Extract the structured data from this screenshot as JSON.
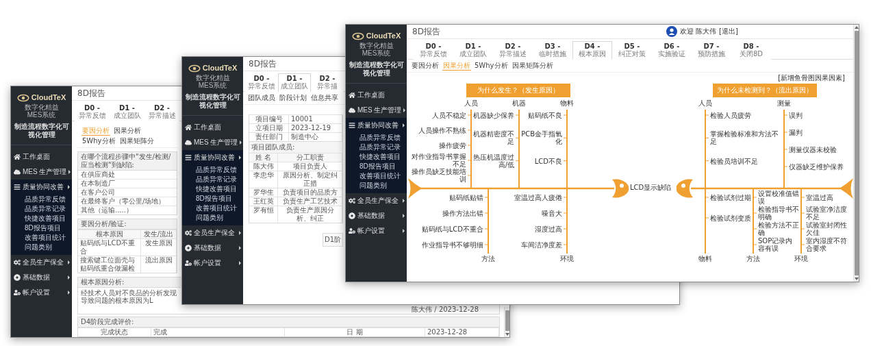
{
  "windows": [
    {
      "kind": "defect_analysis",
      "page_title": "8D报告",
      "sidebar": {
        "logo": "CloudTeX",
        "logo_subtitle": "数字化精益MES系统",
        "tagline": "制造流程数字化可视化管理",
        "menu": [
          {
            "label": "工作桌面",
            "submenu": false,
            "expanded": false
          },
          {
            "label": "MES 生产管理",
            "submenu": true,
            "expanded": false
          },
          {
            "label": "质量协同改善",
            "submenu": true,
            "expanded": true,
            "children": [
              "品质异常反馈",
              "品质异常记录",
              "快捷改善项目",
              "8D报告项目",
              "改善项目统计",
              "问题类别"
            ]
          },
          {
            "label": "全员生产保全",
            "submenu": true,
            "expanded": false
          },
          {
            "label": "基础数据",
            "submenu": true,
            "expanded": false
          },
          {
            "label": "帐户设置",
            "submenu": true,
            "expanded": false
          }
        ]
      },
      "steps": [
        {
          "code": "D0 -",
          "label": "异常反馈",
          "selected": false
        },
        {
          "code": "D1 -",
          "label": "成立团队",
          "selected": false
        },
        {
          "code": "D2 -",
          "label": "异常描述",
          "selected": false
        }
      ],
      "subtabs": [
        {
          "label": "要因分析",
          "selected": true
        },
        {
          "label": "因果分析",
          "selected": false
        },
        {
          "label": "5Why分析",
          "selected": false
        },
        {
          "label": "因果矩阵分",
          "selected": false
        }
      ],
      "location_box": {
        "title": "在哪个流程步骤中\"发生/检测/应当检测\"到缺陷:",
        "options": [
          "在供应商处",
          "在本制造厂",
          "在客户公司",
          "在最终客户（零公里/场地）",
          "其他（运输.....）"
        ]
      },
      "cause_table": {
        "title": "要因分析/验证:",
        "columns": [
          "根本原因",
          "发生/流出"
        ],
        "rows": [
          [
            "贴码纸与LCD不重合",
            "发生原因"
          ],
          [
            "搜索键工位面壳与贴码纸重合做漏检",
            "流出原因"
          ]
        ]
      },
      "root_cause": {
        "title": "根本原因分析:",
        "text": "经技术人员对不良品的分析发现导致问题的根本原因为L",
        "signature": "陈大伟 / 2023-12-28"
      },
      "evaluation": {
        "title": "D4阶段完成评价:",
        "cells": [
          "完成状态",
          "完成",
          "日 期",
          "2023-12-28"
        ]
      }
    },
    {
      "kind": "team",
      "page_title": "8D报告",
      "sidebar": {
        "logo": "CloudTeX",
        "logo_subtitle": "数字化精益MES系统",
        "tagline": "制造流程数字化可视化管理",
        "menu": [
          {
            "label": "工作桌面",
            "submenu": false,
            "expanded": false
          },
          {
            "label": "MES 生产管理",
            "submenu": true,
            "expanded": false
          },
          {
            "label": "质量协同改善",
            "submenu": true,
            "expanded": true,
            "children": [
              "品质异常反馈",
              "品质异常记录",
              "快捷改善项目",
              "8D报告项目",
              "改善项目统计",
              "问题类别"
            ]
          },
          {
            "label": "全员生产保全",
            "submenu": true,
            "expanded": false
          },
          {
            "label": "基础数据",
            "submenu": true,
            "expanded": false
          },
          {
            "label": "帐户设置",
            "submenu": true,
            "expanded": false
          }
        ]
      },
      "steps": [
        {
          "code": "D0 -",
          "label": "异常反馈",
          "selected": false
        },
        {
          "code": "D1 -",
          "label": "成立团队",
          "selected": true
        },
        {
          "code": "D2 -",
          "label": "异常描",
          "selected": false
        }
      ],
      "subtabs": [
        {
          "label": "团队成员",
          "selected": false
        },
        {
          "label": "阶段计划",
          "selected": false
        },
        {
          "label": "信息共享",
          "selected": false
        }
      ],
      "project_info": [
        {
          "label": "项目编号",
          "value": "10001"
        },
        {
          "label": "立项日期",
          "value": "2023-12-19"
        },
        {
          "label": "责任部门",
          "value": "制造中心"
        }
      ],
      "team_title": "项目团队成员:",
      "team_columns": [
        "姓 名",
        "分工职责"
      ],
      "members": [
        {
          "name": "陈大伟",
          "duty": "项目负责人"
        },
        {
          "name": "李忠华",
          "duty": "原因分析、制定纠正措"
        },
        {
          "name": "罗华生",
          "duty": "负责项目的品质方"
        },
        {
          "name": "王红英",
          "duty": "负责生产工艺技术"
        },
        {
          "name": "罗有恒",
          "duty": "负责生产原因分析、纠正"
        }
      ],
      "next_section_title": "D1阶"
    },
    {
      "kind": "fishbone",
      "page_title": "8D报告",
      "user": {
        "greeting": "欢迎 陈大伟",
        "logout": "[退出]"
      },
      "sidebar": {
        "logo": "CloudTeX",
        "logo_subtitle": "数字化精益MES系统",
        "tagline": "制造流程数字化可视化管理",
        "menu": [
          {
            "label": "工作桌面",
            "submenu": false,
            "expanded": false
          },
          {
            "label": "MES 生产管理",
            "submenu": true,
            "expanded": false
          },
          {
            "label": "质量协同改善",
            "submenu": true,
            "expanded": true,
            "children": [
              "品质异常反馈",
              "品质异常记录",
              "快捷改善项目",
              "8D报告项目",
              "改善项目统计",
              "问题类别"
            ]
          },
          {
            "label": "全员生产保全",
            "submenu": true,
            "expanded": false
          },
          {
            "label": "基础数据",
            "submenu": true,
            "expanded": false
          },
          {
            "label": "帐户设置",
            "submenu": true,
            "expanded": false
          }
        ]
      },
      "steps": [
        {
          "code": "D0 -",
          "label": "异常反馈",
          "selected": false
        },
        {
          "code": "D1 -",
          "label": "成立团队",
          "selected": false
        },
        {
          "code": "D2 -",
          "label": "异常描述",
          "selected": false
        },
        {
          "code": "D3 -",
          "label": "临时措施",
          "selected": false
        },
        {
          "code": "D4 -",
          "label": "根本原因",
          "selected": true
        },
        {
          "code": "D5 -",
          "label": "纠正对策",
          "selected": false
        },
        {
          "code": "D6 -",
          "label": "实施验证",
          "selected": false
        },
        {
          "code": "D7 -",
          "label": "预防措施",
          "selected": false
        },
        {
          "code": "D8 -",
          "label": "关闭8D",
          "selected": false
        }
      ],
      "subtabs": [
        {
          "label": "要因分析",
          "selected": false
        },
        {
          "label": "因果分析",
          "selected": true
        },
        {
          "label": "5Why分析",
          "selected": false
        },
        {
          "label": "因果矩阵分析",
          "selected": false
        }
      ],
      "add_link": "[新增鱼骨图因果因素]",
      "diagram": {
        "effect": "LCD显示缺陷",
        "fishes": [
          {
            "title": "为什么发生？（发生原因）",
            "head_right": true,
            "top_categories": [
              {
                "name": "人员",
                "causes": [
                  "人员不稳定",
                  "人员操作不熟练",
                  "操作疲劳",
                  "对作业指导书掌握不足",
                  "操作员缺乏技能培训"
                ]
              },
              {
                "name": "机器",
                "causes": [
                  "机器缺少保养",
                  "机器精密度不足",
                  "热压机温度过高/低"
                ]
              },
              {
                "name": "物料",
                "causes": [
                  "贴码纸不良",
                  "PCB金手指氧化",
                  "LCD不良"
                ]
              }
            ],
            "bottom_categories": [
              {
                "name": "方法",
                "causes": [
                  "贴码纸贴错",
                  "操作方法出错",
                  "贴码纸与LCD不重合",
                  "作业指导书不够明细"
                ]
              },
              {
                "name": "环境",
                "causes": [
                  "室温过高人疲倦",
                  "噪音大",
                  "湿度过高",
                  "车间洁净度差"
                ]
              }
            ]
          },
          {
            "title": "为什么未检测到？（流出原因）",
            "head_right": false,
            "top_categories": [
              {
                "name": "人员",
                "causes": [
                  "检验人员疲劳",
                  "掌握检验标准和方法不足",
                  "检验员培训不足"
                ]
              },
              {
                "name": "测量",
                "causes": [
                  "误判",
                  "漏判",
                  "测量仪器未校验",
                  "仪器缺乏维护保养"
                ]
              }
            ],
            "bottom_categories": [
              {
                "name": "物料",
                "causes": [
                  "检验试剂过期",
                  "检验试剂变质"
                ]
              },
              {
                "name": "方法",
                "causes": [
                  "设置校准值错误",
                  "检验指导书不明确",
                  "检验方法不正确",
                  "SOP记录内容有误"
                ]
              },
              {
                "name": "环境",
                "causes": [
                  "室温过高",
                  "试验室净洁度不足",
                  "试验室封闭性欠佳",
                  "室内湿度不符合要求"
                ]
              }
            ]
          }
        ]
      }
    }
  ]
}
